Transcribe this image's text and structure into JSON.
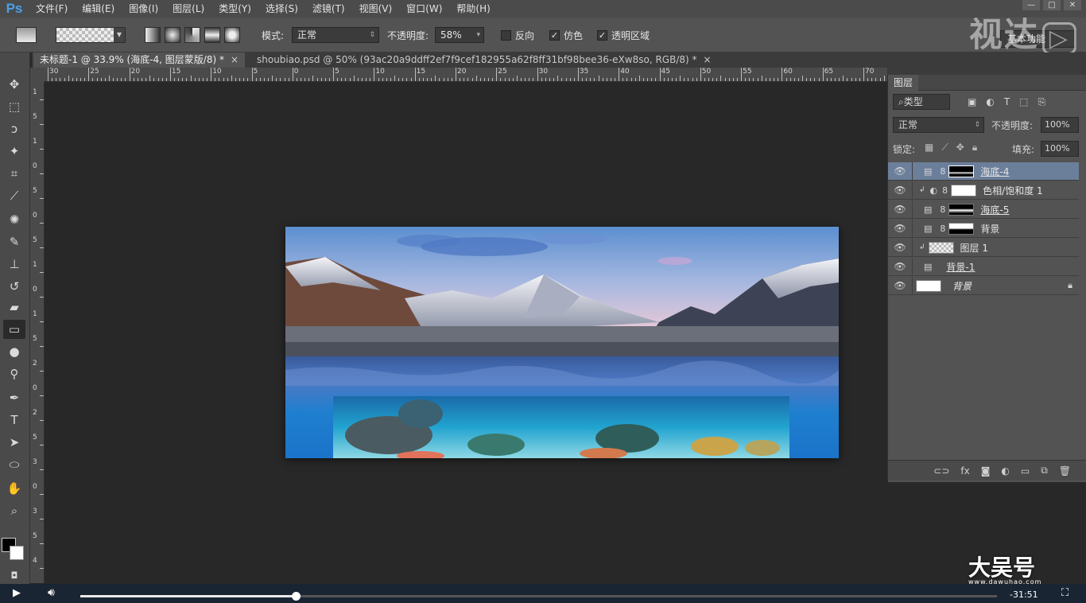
{
  "app": {
    "logo": "Ps"
  },
  "menu": [
    "文件(F)",
    "编辑(E)",
    "图像(I)",
    "图层(L)",
    "类型(Y)",
    "选择(S)",
    "滤镜(T)",
    "视图(V)",
    "窗口(W)",
    "帮助(H)"
  ],
  "window_controls": [
    "—",
    "□",
    "✕"
  ],
  "options": {
    "mode_label": "模式:",
    "mode_value": "正常",
    "opacity_label": "不透明度:",
    "opacity_value": "58%",
    "reverse_label": "反向",
    "dither_label": "仿色",
    "transparency_label": "透明区域",
    "workspace": "基本功能"
  },
  "watermark": {
    "logo_text": "视达",
    "brand": "大吴号",
    "url": "www.dawuhao.com"
  },
  "tabs": [
    {
      "label": "未标题-1 @ 33.9% (海底-4, 图层蒙版/8) *"
    },
    {
      "label": "shoubiao.psd @ 50% (93ac20a9ddff2ef7f9cef182955a62f8ff31bf98bee36-eXw8so, RGB/8) *"
    }
  ],
  "ruler": {
    "h_labels": [
      "30",
      "25",
      "20",
      "15",
      "10",
      "5",
      "0",
      "5",
      "10",
      "15",
      "20",
      "25",
      "30",
      "35",
      "40",
      "45",
      "50",
      "55",
      "60",
      "65",
      "70"
    ],
    "v_labels": [
      "1",
      "5",
      "1",
      "0",
      "5",
      "0",
      "5",
      "1",
      "0",
      "1",
      "5",
      "2",
      "0",
      "2",
      "5",
      "3",
      "0",
      "3",
      "5",
      "4"
    ]
  },
  "layers_panel": {
    "title": "图层",
    "filter_kind": "类型",
    "blend_mode": "正常",
    "opacity_label": "不透明度:",
    "opacity_value": "100%",
    "lock_label": "锁定:",
    "fill_label": "填充:",
    "fill_value": "100%",
    "layers": [
      {
        "name": "海底-4",
        "selected": true
      },
      {
        "name": "色相/饱和度 1",
        "selected": false
      },
      {
        "name": "海底-5",
        "selected": false
      },
      {
        "name": "背景",
        "selected": false
      },
      {
        "name": "图层 1",
        "selected": false
      },
      {
        "name": "背景-1",
        "selected": false
      },
      {
        "name": "背景",
        "selected": false
      }
    ]
  },
  "video": {
    "time": "-31:51",
    "progress": 0.235
  }
}
